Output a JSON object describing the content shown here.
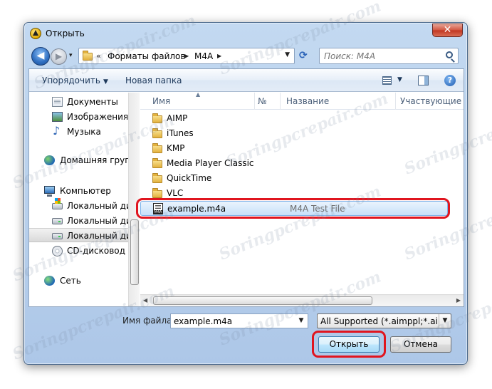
{
  "window": {
    "title": "Открыть"
  },
  "titlebar": {
    "close_glyph": "✕"
  },
  "nav": {
    "back_glyph": "◀",
    "forward_glyph": "▶",
    "history_glyph": "▾",
    "refresh_glyph": "⟳"
  },
  "address": {
    "root_chevron": "«",
    "crumbs": [
      "Форматы файлов",
      "M4A"
    ],
    "sep_glyph": "▶",
    "dropdown_glyph": "▼"
  },
  "search": {
    "placeholder": "Поиск: M4A"
  },
  "toolbar": {
    "organize_label": "Упорядочить",
    "organize_caret": "▼",
    "new_folder_label": "Новая папка",
    "views_caret": "▼",
    "help_glyph": "?"
  },
  "sidebar": {
    "items": [
      {
        "label": "Документы",
        "icon": "documents-icon"
      },
      {
        "label": "Изображения",
        "icon": "pictures-icon"
      },
      {
        "label": "Музыка",
        "icon": "music-icon"
      },
      {
        "label": "Домашняя групп",
        "icon": "homegroup-icon"
      },
      {
        "label": "Компьютер",
        "icon": "computer-icon"
      },
      {
        "label": "Локальный дис",
        "icon": "system-drive-icon"
      },
      {
        "label": "Локальный дис",
        "icon": "drive-icon"
      },
      {
        "label": "Локальный дис",
        "icon": "drive-icon"
      },
      {
        "label": "CD-дисковод (H",
        "icon": "cd-drive-icon"
      },
      {
        "label": "Сеть",
        "icon": "network-icon"
      }
    ]
  },
  "columns": {
    "name": "Имя",
    "number": "№",
    "title": "Название",
    "participants": "Участвующие и",
    "sort_glyph": "▲"
  },
  "files": [
    {
      "name": "AIMP",
      "type": "",
      "kind": "folder"
    },
    {
      "name": "iTunes",
      "type": "",
      "kind": "folder"
    },
    {
      "name": "KMP",
      "type": "",
      "kind": "folder"
    },
    {
      "name": "Media Player Classic",
      "type": "",
      "kind": "folder"
    },
    {
      "name": "QuickTime",
      "type": "",
      "kind": "folder"
    },
    {
      "name": "VLC",
      "type": "",
      "kind": "folder"
    },
    {
      "name": "example.m4a",
      "type": "M4A Test File",
      "kind": "m4a"
    }
  ],
  "hscroll": {
    "left_glyph": "◀",
    "right_glyph": "▶"
  },
  "bottom": {
    "filename_label": "Имя файла:",
    "filename_value": "example.m4a",
    "filename_drop": "▼",
    "filter_value": "All Supported (*.aimppl;*.aimpp",
    "filter_drop": "▼",
    "open_label": "Открыть",
    "cancel_label": "Отмена"
  },
  "watermark": {
    "text": "Soringpcrepair.com"
  },
  "colors": {
    "highlight": "#e0151f",
    "selection": "#c7e1f9"
  }
}
